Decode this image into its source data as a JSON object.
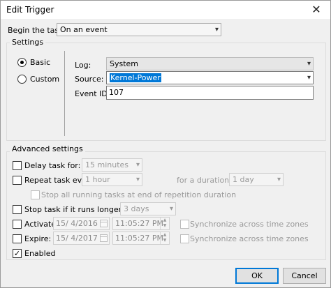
{
  "window": {
    "title": "Edit Trigger",
    "close_glyph": "✕"
  },
  "begin_task": {
    "label": "Begin the task:",
    "value": "On an event"
  },
  "settings": {
    "caption": "Settings",
    "basic_label": "Basic",
    "custom_label": "Custom",
    "log_label": "Log:",
    "log_value": "System",
    "source_label": "Source:",
    "source_value": "Kernel-Power",
    "event_id_label": "Event ID:",
    "event_id_value": "107"
  },
  "advanced": {
    "caption": "Advanced settings",
    "delay_label": "Delay task for:",
    "delay_value": "15 minutes",
    "repeat_label": "Repeat task every:",
    "repeat_value": "1 hour",
    "duration_label": "for a duration of:",
    "duration_value": "1 day",
    "stop_running_label": "Stop all running tasks at end of repetition duration",
    "stop_longer_label": "Stop task if it runs longer than:",
    "stop_longer_value": "3 days",
    "activate_label": "Activate:",
    "activate_date": "15/  4/2016",
    "activate_time": "11:05:27 PM",
    "expire_label": "Expire:",
    "expire_date": "15/  4/2017",
    "expire_time": "11:05:27 PM",
    "sync_label": "Synchronize across time zones",
    "enabled_label": "Enabled",
    "check_glyph": "✓"
  },
  "buttons": {
    "ok": "OK",
    "cancel": "Cancel"
  },
  "colors": {
    "selection": "#0078d7",
    "default_button_border": "#0078d7"
  },
  "icons": {
    "dropdown": "▾",
    "spin_up": "▲",
    "spin_down": "▼"
  }
}
